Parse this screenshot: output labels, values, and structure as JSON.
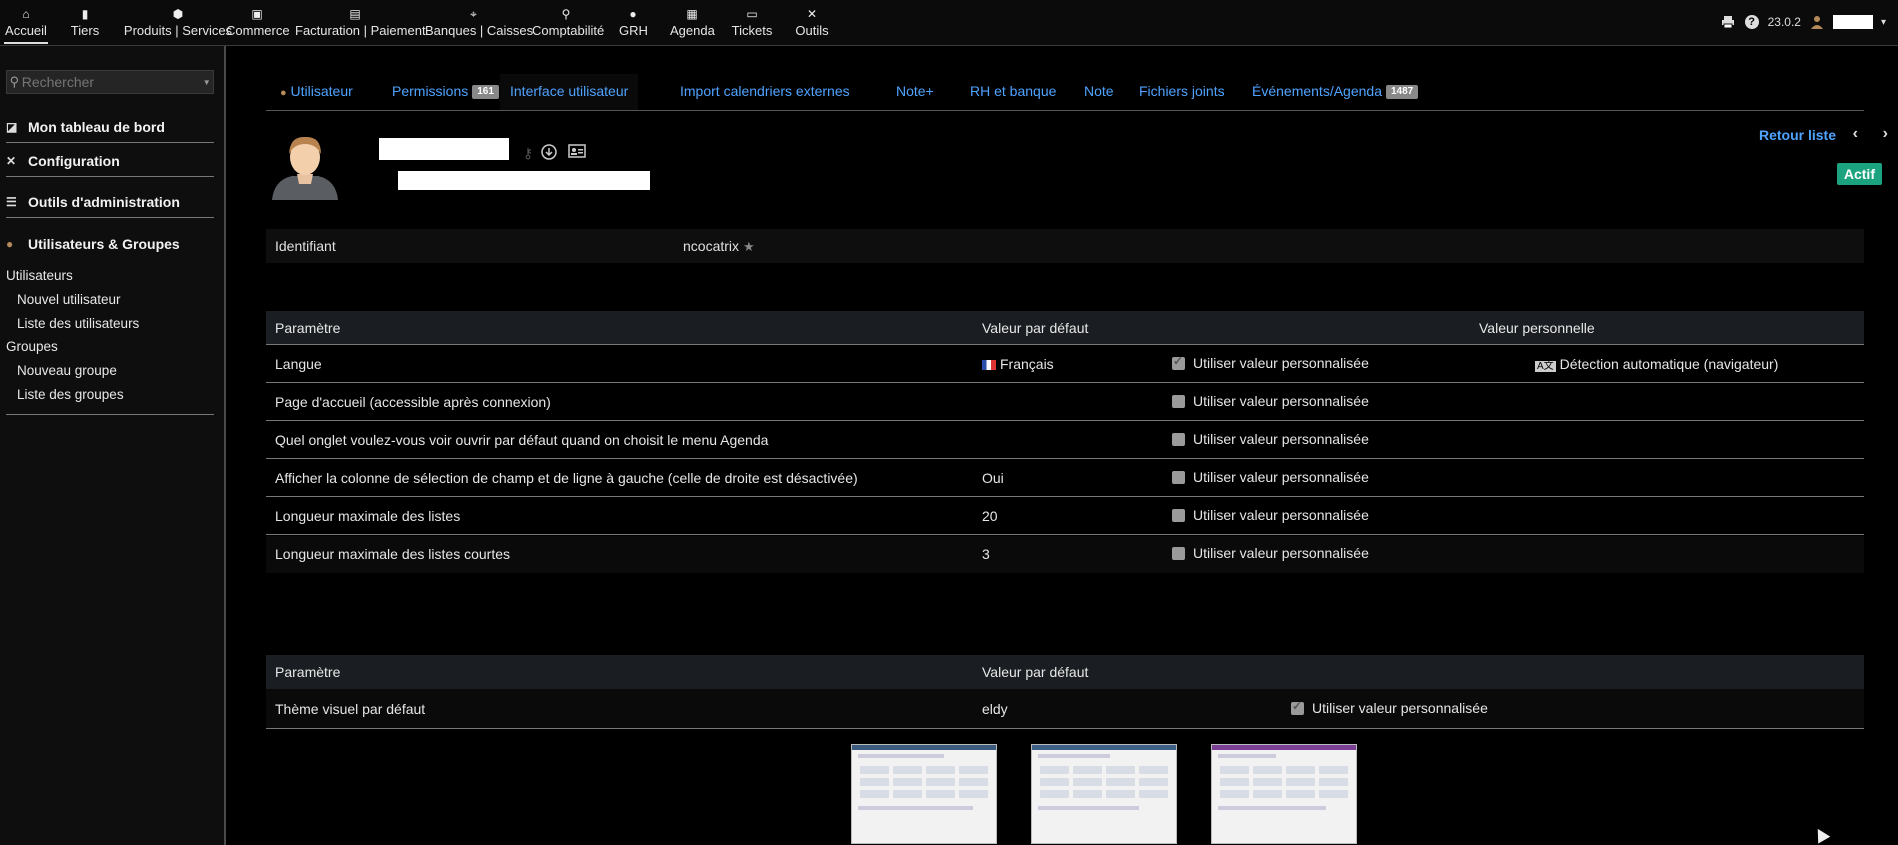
{
  "topbar": {
    "menu": [
      {
        "label": "Accueil",
        "icon": "home-icon",
        "glyph": "⌂"
      },
      {
        "label": "Tiers",
        "icon": "building-icon",
        "glyph": "▮"
      },
      {
        "label": "Produits | Services",
        "icon": "cube-icon",
        "glyph": "⬢"
      },
      {
        "label": "Commerce",
        "icon": "suitcase-icon",
        "glyph": "▣"
      },
      {
        "label": "Facturation | Paiement",
        "icon": "file-invoice-icon",
        "glyph": "▤"
      },
      {
        "label": "Banques | Caisses",
        "icon": "bank-icon",
        "glyph": "⌖"
      },
      {
        "label": "Comptabilité",
        "icon": "magnifier-icon",
        "glyph": "⚲"
      },
      {
        "label": "GRH",
        "icon": "user-tie-icon",
        "glyph": "●"
      },
      {
        "label": "Agenda",
        "icon": "calendar-icon",
        "glyph": "▦"
      },
      {
        "label": "Tickets",
        "icon": "ticket-icon",
        "glyph": "▭"
      },
      {
        "label": "Outils",
        "icon": "tools-icon",
        "glyph": "✕"
      }
    ],
    "version": "23.0.2"
  },
  "leftpanel": {
    "search_placeholder": "Rechercher",
    "sections": [
      {
        "label": "Mon tableau de bord",
        "icon": "chart-line-icon",
        "glyph": "◪"
      },
      {
        "label": "Configuration",
        "icon": "wrench-icon",
        "glyph": "✕"
      },
      {
        "label": "Outils d'administration",
        "icon": "server-icon",
        "glyph": "☰"
      },
      {
        "label": "Utilisateurs & Groupes",
        "icon": "user-icon",
        "glyph": "●"
      }
    ],
    "links": {
      "utilisateurs": "Utilisateurs",
      "nouvel_utilisateur": "Nouvel utilisateur",
      "liste_utilisateurs": "Liste des utilisateurs",
      "groupes": "Groupes",
      "nouveau_groupe": "Nouveau groupe",
      "liste_groupes": "Liste des groupes"
    }
  },
  "tabs": [
    {
      "label": "Utilisateur",
      "badge": ""
    },
    {
      "label": "Permissions",
      "badge": "161"
    },
    {
      "label": "Interface utilisateur",
      "badge": ""
    },
    {
      "label": "Import calendriers externes",
      "badge": ""
    },
    {
      "label": "Note+",
      "badge": ""
    },
    {
      "label": "RH et banque",
      "badge": ""
    },
    {
      "label": "Note",
      "badge": ""
    },
    {
      "label": "Fichiers joints",
      "badge": ""
    },
    {
      "label": "Événements/Agenda",
      "badge": "1487"
    }
  ],
  "banner": {
    "retour": "Retour liste",
    "status": "Actif",
    "status_color": "#1ba37f"
  },
  "ident": {
    "label": "Identifiant",
    "value": "ncocatrix"
  },
  "params": {
    "headers": [
      "Paramètre",
      "Valeur par défaut",
      "Valeur personnelle"
    ],
    "custom_label": "Utiliser valeur personnalisée",
    "rows": [
      {
        "param": "Langue",
        "default": "Français",
        "checked": true,
        "personal": "Détection automatique (navigateur)"
      },
      {
        "param": "Page d'accueil (accessible après connexion)",
        "default": "",
        "checked": false,
        "personal": ""
      },
      {
        "param": "Quel onglet voulez-vous voir ouvrir par défaut quand on choisit le menu Agenda",
        "default": "",
        "checked": false,
        "personal": ""
      },
      {
        "param": "Afficher la colonne de sélection de champ et de ligne à gauche (celle de droite est désactivée)",
        "default": "Oui",
        "checked": false,
        "personal": ""
      },
      {
        "param": "Longueur maximale des listes",
        "default": "20",
        "checked": false,
        "personal": ""
      },
      {
        "param": "Longueur maximale des listes courtes",
        "default": "3",
        "checked": false,
        "personal": ""
      }
    ]
  },
  "theme": {
    "headers": [
      "Paramètre",
      "Valeur par défaut"
    ],
    "row": {
      "param": "Thème visuel par défaut",
      "default": "eldy",
      "checked": true,
      "custom": "Utiliser valeur personnalisée"
    }
  },
  "colors": {
    "link": "#4ea3ff",
    "accent_green": "#1ba37f"
  }
}
